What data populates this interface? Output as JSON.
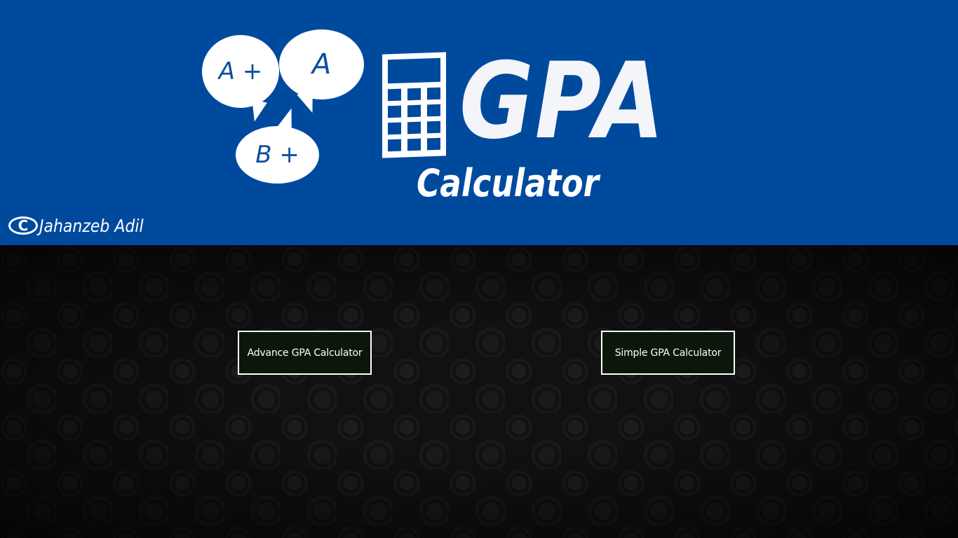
{
  "header": {
    "bubbles": [
      "A +",
      "A",
      "B +"
    ],
    "logo_title": "GPA",
    "logo_subtitle": "Calculator",
    "credit_symbol": "C",
    "credit_name": "Jahanzeb Adil",
    "background_color": "#004a9e"
  },
  "main": {
    "buttons": [
      {
        "label": "Advance GPA Calculator"
      },
      {
        "label": "Simple GPA Calculator"
      }
    ],
    "button_background": "#0b170b",
    "background_color": "#111111"
  },
  "icons": [
    "calculator-icon",
    "copyright-icon",
    "speech-bubble-icon"
  ]
}
